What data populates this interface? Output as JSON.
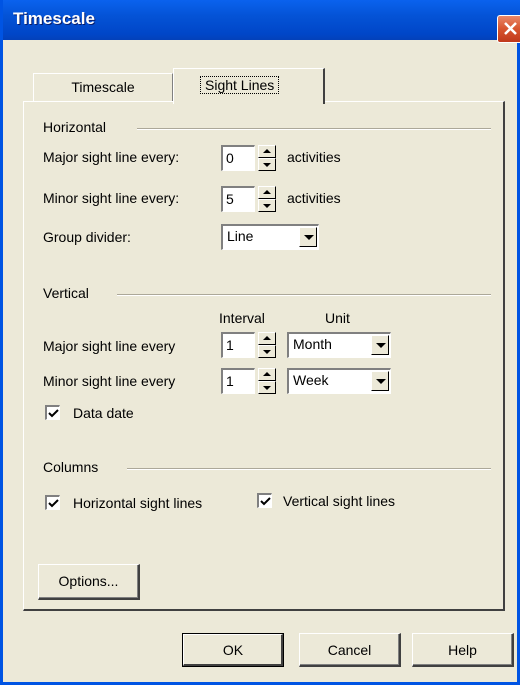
{
  "window": {
    "title": "Timescale"
  },
  "tabs": [
    {
      "label": "Timescale",
      "selected": false
    },
    {
      "label": "Sight Lines",
      "selected": true
    }
  ],
  "horizontal": {
    "heading": "Horizontal",
    "major_label": "Major sight line every:",
    "major_value": "0",
    "major_unit": "activities",
    "minor_label": "Minor sight line every:",
    "minor_value": "5",
    "minor_unit": "activities",
    "group_divider_label": "Group divider:",
    "group_divider_value": "Line"
  },
  "vertical": {
    "heading": "Vertical",
    "interval_header": "Interval",
    "unit_header": "Unit",
    "major_label": "Major sight line every",
    "major_interval": "1",
    "major_unit": "Month",
    "minor_label": "Minor sight line every",
    "minor_interval": "1",
    "minor_unit": "Week",
    "data_date_label": "Data date",
    "data_date_checked": true
  },
  "columns": {
    "heading": "Columns",
    "horizontal_label": "Horizontal sight lines",
    "horizontal_checked": true,
    "vertical_label": "Vertical sight lines",
    "vertical_checked": true
  },
  "buttons": {
    "options": "Options...",
    "ok": "OK",
    "cancel": "Cancel",
    "help": "Help"
  },
  "icons": {
    "close": "close-icon",
    "check": "checkmark-icon"
  }
}
